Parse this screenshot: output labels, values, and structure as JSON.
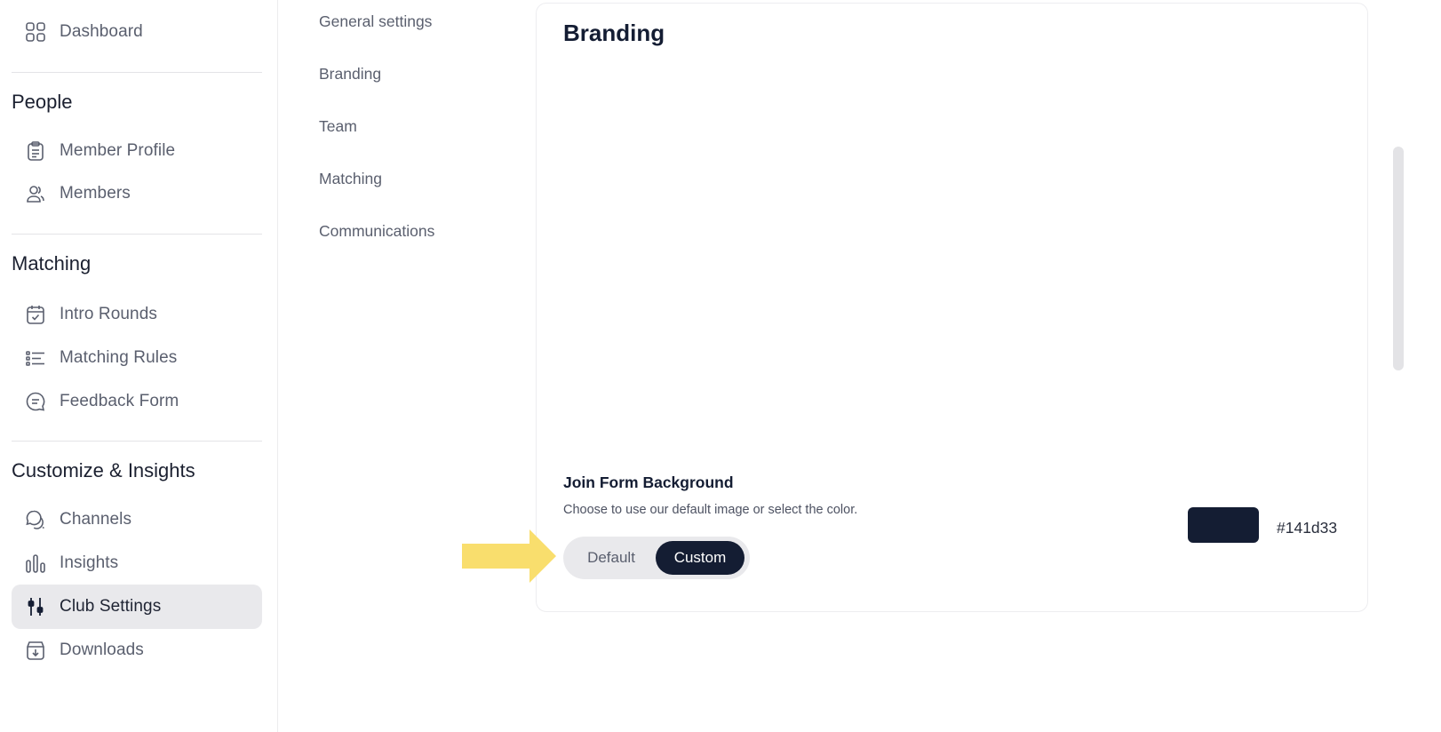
{
  "sidebar": {
    "dashboard": {
      "label": "Dashboard",
      "icon": "grid-icon"
    },
    "sections": [
      {
        "title": "People",
        "items": [
          {
            "label": "Member Profile",
            "icon": "clipboard-icon"
          },
          {
            "label": "Members",
            "icon": "users-icon"
          }
        ]
      },
      {
        "title": "Matching",
        "items": [
          {
            "label": "Intro Rounds",
            "icon": "calendar-check-icon"
          },
          {
            "label": "Matching Rules",
            "icon": "list-icon"
          },
          {
            "label": "Feedback Form",
            "icon": "message-icon"
          }
        ]
      },
      {
        "title": "Customize & Insights",
        "items": [
          {
            "label": "Channels",
            "icon": "chat-bubbles-icon"
          },
          {
            "label": "Insights",
            "icon": "bar-chart-icon"
          },
          {
            "label": "Club Settings",
            "icon": "sliders-icon",
            "active": true
          },
          {
            "label": "Downloads",
            "icon": "download-box-icon"
          }
        ]
      }
    ]
  },
  "subnav": [
    "General settings",
    "Branding",
    "Team",
    "Matching",
    "Communications"
  ],
  "card": {
    "title": "Branding",
    "section_heading": "Join Form Background",
    "section_desc": "Choose to use our default image or select the color.",
    "toggle": {
      "default_label": "Default",
      "custom_label": "Custom",
      "selected": "Custom"
    },
    "color_hex": "#141d33"
  },
  "colors": {
    "accent": "#141d33",
    "arrow": "#f9de6d",
    "active_bg": "#e9e9ec"
  }
}
